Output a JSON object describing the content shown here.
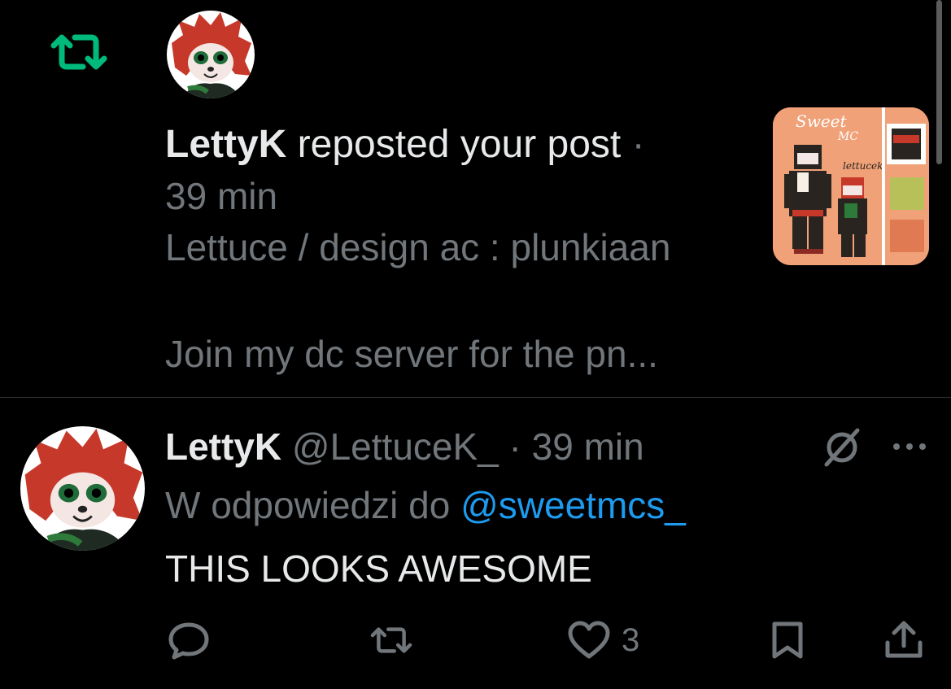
{
  "notification": {
    "user": "LettyK",
    "action": " reposted your post",
    "dot": " ·",
    "time": "39 min",
    "snippet_line1": "Lettuce / design ac : plunkiaan",
    "snippet_line2": "Join my dc server for the pn...",
    "thumbnail": {
      "brand_line1": "Sweet",
      "brand_line2": "MC",
      "signature": "lettucek",
      "colors": [
        "#f0a178",
        "#b8c05a",
        "#e07a52",
        "#2a2420",
        "#c6392a"
      ]
    }
  },
  "reply": {
    "name": "LettyK",
    "handle": "@LettuceK_",
    "sep": " · ",
    "time": "39 min",
    "reply_prefix": "W odpowiedzi do ",
    "reply_target": "@sweetmcs_",
    "body": "THIS LOOKS AWESOME",
    "like_count": "3"
  },
  "icons": {
    "repost": "repost-icon",
    "reply": "reply-icon",
    "like": "heart-icon",
    "bookmark": "bookmark-icon",
    "share": "share-icon",
    "grok": "grok-icon",
    "more": "more-icon"
  },
  "colors": {
    "background": "#000000",
    "text": "#e7e9ea",
    "secondary": "#71767b",
    "link": "#1d9bf0",
    "repost_green": "#00ba7c",
    "divider": "#2f3336"
  }
}
